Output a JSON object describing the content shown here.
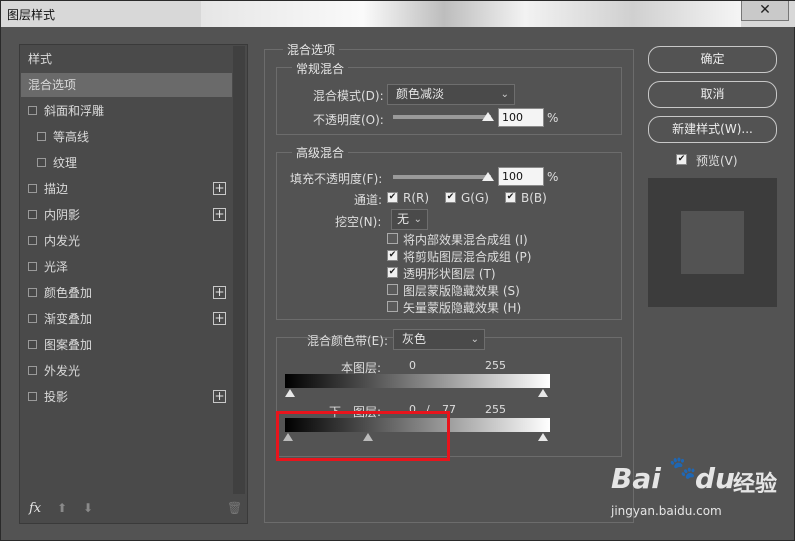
{
  "window": {
    "title": "图层样式",
    "close_glyph": "✕"
  },
  "left_panel": {
    "items": [
      {
        "label": "样式",
        "checkbox": false,
        "plus": false,
        "indent": 0,
        "selected": false
      },
      {
        "label": "混合选项",
        "checkbox": false,
        "plus": false,
        "indent": 0,
        "selected": true
      },
      {
        "label": "斜面和浮雕",
        "checkbox": true,
        "plus": false,
        "indent": 0,
        "selected": false
      },
      {
        "label": "等高线",
        "checkbox": true,
        "plus": false,
        "indent": 1,
        "selected": false
      },
      {
        "label": "纹理",
        "checkbox": true,
        "plus": false,
        "indent": 1,
        "selected": false
      },
      {
        "label": "描边",
        "checkbox": true,
        "plus": true,
        "indent": 0,
        "selected": false
      },
      {
        "label": "内阴影",
        "checkbox": true,
        "plus": true,
        "indent": 0,
        "selected": false
      },
      {
        "label": "内发光",
        "checkbox": true,
        "plus": false,
        "indent": 0,
        "selected": false
      },
      {
        "label": "光泽",
        "checkbox": true,
        "plus": false,
        "indent": 0,
        "selected": false
      },
      {
        "label": "颜色叠加",
        "checkbox": true,
        "plus": true,
        "indent": 0,
        "selected": false
      },
      {
        "label": "渐变叠加",
        "checkbox": true,
        "plus": true,
        "indent": 0,
        "selected": false
      },
      {
        "label": "图案叠加",
        "checkbox": true,
        "plus": false,
        "indent": 0,
        "selected": false
      },
      {
        "label": "外发光",
        "checkbox": true,
        "plus": false,
        "indent": 0,
        "selected": false
      },
      {
        "label": "投影",
        "checkbox": true,
        "plus": true,
        "indent": 0,
        "selected": false
      }
    ],
    "footer": {
      "fx": "fx",
      "up": "⬆",
      "down": "⬇",
      "trash": "🗑"
    }
  },
  "blend_options": {
    "title": "混合选项",
    "general": {
      "title": "常规混合",
      "mode_label": "混合模式(D):",
      "mode_value": "颜色减淡",
      "opacity_label": "不透明度(O):",
      "opacity_value": "100",
      "opacity_level": 100,
      "percent": "%"
    },
    "advanced": {
      "title": "高级混合",
      "fill_label": "填充不透明度(F):",
      "fill_value": "100",
      "fill_level": 100,
      "percent": "%",
      "channels_label": "通道:",
      "channels": [
        {
          "label": "R(R)",
          "checked": true
        },
        {
          "label": "G(G)",
          "checked": true
        },
        {
          "label": "B(B)",
          "checked": true
        }
      ],
      "knockout_label": "挖空(N):",
      "knockout_value": "无",
      "options": [
        {
          "label": "将内部效果混合成组 (I)",
          "checked": false
        },
        {
          "label": "将剪贴图层混合成组 (P)",
          "checked": true
        },
        {
          "label": "透明形状图层 (T)",
          "checked": true
        },
        {
          "label": "图层蒙版隐藏效果 (S)",
          "checked": false
        },
        {
          "label": "矢量蒙版隐藏效果 (H)",
          "checked": false
        }
      ]
    },
    "blend_if": {
      "label": "混合颜色带(E):",
      "value": "灰色",
      "this_layer": {
        "label": "本图层:",
        "low": "0",
        "high": "255"
      },
      "underlying": {
        "label": "下一图层:",
        "low": "0",
        "sep": "/",
        "mid": "77",
        "high": "255"
      }
    }
  },
  "buttons": {
    "ok": "确定",
    "cancel": "取消",
    "new_style": "新建样式(W)...",
    "preview_label": "预览(V)",
    "preview_checked": true
  },
  "watermark": {
    "brand_a": "Bai",
    "brand_b": "du",
    "brand_c": "经验",
    "url": "jingyan.baidu.com"
  },
  "colors": {
    "dialog_bg": "#535353",
    "highlight": "#e8141c",
    "selected_item": "#6a6a6a"
  }
}
